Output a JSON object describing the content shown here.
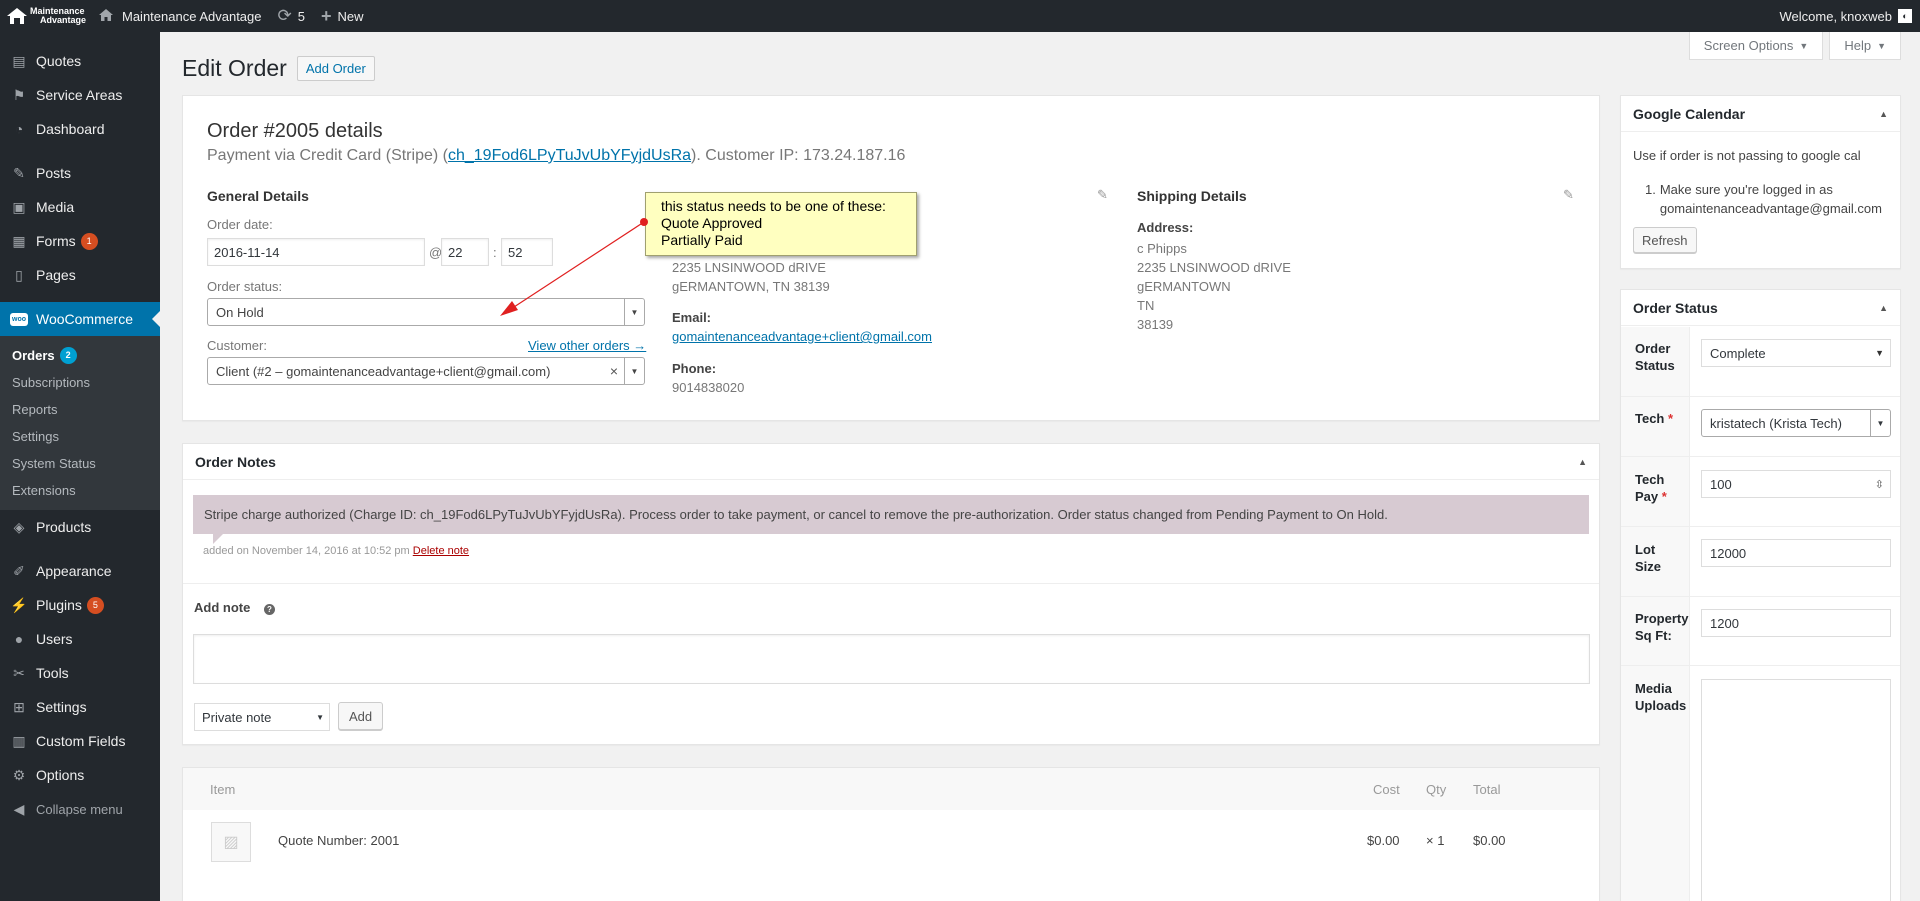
{
  "adminbar": {
    "logo_line1": "Maintenance",
    "logo_line2": "Advantage",
    "site_name": "Maintenance Advantage",
    "updates_count": "5",
    "new_label": "New",
    "welcome": "Welcome, knoxweb"
  },
  "sidebar": {
    "items": [
      {
        "label": "Quotes",
        "icon": "quotes-icon"
      },
      {
        "label": "Service Areas",
        "icon": "map-icon"
      },
      {
        "label": "Dashboard",
        "icon": "dashboard-icon"
      },
      {
        "label": "Posts",
        "icon": "pin-icon"
      },
      {
        "label": "Media",
        "icon": "media-icon"
      },
      {
        "label": "Forms",
        "icon": "forms-icon",
        "badge": "1"
      },
      {
        "label": "Pages",
        "icon": "pages-icon"
      },
      {
        "label": "WooCommerce",
        "icon": "woo-icon"
      },
      {
        "label": "Products",
        "icon": "products-icon"
      },
      {
        "label": "Appearance",
        "icon": "brush-icon"
      },
      {
        "label": "Plugins",
        "icon": "plugin-icon",
        "badge": "5"
      },
      {
        "label": "Users",
        "icon": "users-icon"
      },
      {
        "label": "Tools",
        "icon": "wrench-icon"
      },
      {
        "label": "Settings",
        "icon": "settings-icon"
      },
      {
        "label": "Custom Fields",
        "icon": "grid-icon"
      },
      {
        "label": "Options",
        "icon": "gear-icon"
      },
      {
        "label": "Collapse menu",
        "icon": "collapse-icon"
      }
    ],
    "submenu": [
      {
        "label": "Orders",
        "badge": "2"
      },
      {
        "label": "Subscriptions"
      },
      {
        "label": "Reports"
      },
      {
        "label": "Settings"
      },
      {
        "label": "System Status"
      },
      {
        "label": "Extensions"
      }
    ]
  },
  "screen_options": "Screen Options",
  "help": "Help",
  "page": {
    "title": "Edit Order",
    "add_order": "Add Order"
  },
  "order": {
    "heading": "Order #2005 details",
    "payment_prefix": "Payment via Credit Card (Stripe) (",
    "charge_id": "ch_19Fod6LPyTuJvUbYFyjdUsRa",
    "payment_suffix": "). Customer IP: 173.24.187.16",
    "general_title": "General Details",
    "order_date_label": "Order date:",
    "order_date": "2016-11-14",
    "at": "@",
    "hour": "22",
    "colon": ":",
    "minute": "52",
    "status_label": "Order status:",
    "status": "On Hold",
    "customer_label": "Customer:",
    "view_other": "View other orders →",
    "customer": "Client (#2 – gomaintenanceadvantage+client@gmail.com)",
    "billing_addr1": "2235 LNSINWOOD dRIVE",
    "billing_addr2": "gERMANTOWN, TN 38139",
    "email_label": "Email:",
    "email": "gomaintenanceadvantage+client@gmail.com",
    "phone_label": "Phone:",
    "phone": "9014838020",
    "shipping_title": "Shipping Details",
    "address_label": "Address:",
    "ship_lines": [
      "c Phipps",
      "2235 LNSINWOOD dRIVE",
      "gERMANTOWN",
      "TN",
      "38139"
    ]
  },
  "annotation": {
    "line1": "this status needs to be one of these:",
    "line2": "Quote Approved",
    "line3": "Partially Paid"
  },
  "notes": {
    "title": "Order Notes",
    "note_text": "Stripe charge authorized (Charge ID: ch_19Fod6LPyTuJvUbYFyjdUsRa). Process order to take payment, or cancel to remove the pre-authorization. Order status changed from Pending Payment to On Hold.",
    "note_meta": "added on November 14, 2016 at 10:52 pm",
    "delete_note": "Delete note",
    "add_note_label": "Add note",
    "help_glyph": "?",
    "note_type": "Private note",
    "add_button": "Add"
  },
  "items": {
    "col_item": "Item",
    "col_cost": "Cost",
    "col_qty": "Qty",
    "col_total": "Total",
    "rows": [
      {
        "name": "Quote Number: 2001",
        "cost": "$0.00",
        "qty": "× 1",
        "total": "$0.00"
      }
    ]
  },
  "google_calendar": {
    "title": "Google Calendar",
    "desc": "Use if order is not passing to google cal",
    "step_num": "1.",
    "step1": "Make sure you're logged in as",
    "step2": "gomaintenanceadvantage@gmail.com",
    "refresh": "Refresh"
  },
  "order_status_box": {
    "title": "Order Status",
    "order_status_label1": "Order",
    "order_status_label2": "Status",
    "order_status_value": "Complete",
    "tech_label": "Tech",
    "tech_value": "kristatech (Krista Tech)",
    "tech_pay_label1": "Tech",
    "tech_pay_label2": "Pay",
    "tech_pay_value": "100",
    "lot_size_label1": "Lot",
    "lot_size_label2": "Size",
    "lot_size_value": "12000",
    "sqft_label1": "Property",
    "sqft_label2": "Sq Ft:",
    "sqft_value": "1200",
    "media_label1": "Media",
    "media_label2": "Uploads",
    "required": "*"
  },
  "colors": {
    "admin_dark": "#23282d",
    "accent": "#0073aa",
    "note_bg": "#d7cad2",
    "annotation_bg": "#ffffc0",
    "arrow": "#e02020"
  }
}
